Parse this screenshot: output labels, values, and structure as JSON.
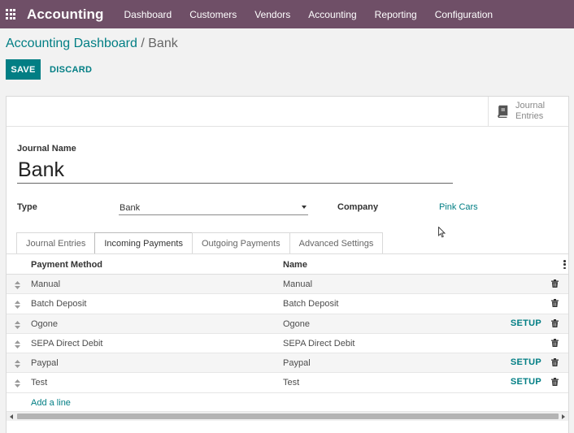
{
  "navbar": {
    "brand": "Accounting",
    "items": [
      "Dashboard",
      "Customers",
      "Vendors",
      "Accounting",
      "Reporting",
      "Configuration"
    ]
  },
  "breadcrumb": {
    "parent": "Accounting Dashboard",
    "separator": "/",
    "current": "Bank"
  },
  "actions": {
    "save": "SAVE",
    "discard": "DISCARD"
  },
  "smart_button": {
    "label_line1": "Journal",
    "label_line2": "Entries"
  },
  "form": {
    "journal_name_label": "Journal Name",
    "journal_name_value": "Bank",
    "type_label": "Type",
    "type_value": "Bank",
    "company_label": "Company",
    "company_value": "Pink Cars"
  },
  "tabs": [
    {
      "label": "Journal Entries",
      "active": false
    },
    {
      "label": "Incoming Payments",
      "active": true
    },
    {
      "label": "Outgoing Payments",
      "active": false
    },
    {
      "label": "Advanced Settings",
      "active": false
    }
  ],
  "table": {
    "columns": [
      "Payment Method",
      "Name"
    ],
    "rows": [
      {
        "method": "Manual",
        "name": "Manual",
        "setup": ""
      },
      {
        "method": "Batch Deposit",
        "name": "Batch Deposit",
        "setup": ""
      },
      {
        "method": "Ogone",
        "name": "Ogone",
        "setup": "SETUP"
      },
      {
        "method": "SEPA Direct Debit",
        "name": "SEPA Direct Debit",
        "setup": ""
      },
      {
        "method": "Paypal",
        "name": "Paypal",
        "setup": "SETUP"
      },
      {
        "method": "Test",
        "name": "Test",
        "setup": "SETUP"
      }
    ],
    "add_line": "Add a line"
  },
  "colors": {
    "navbar": "#6f4f67",
    "primary": "#017e84"
  }
}
